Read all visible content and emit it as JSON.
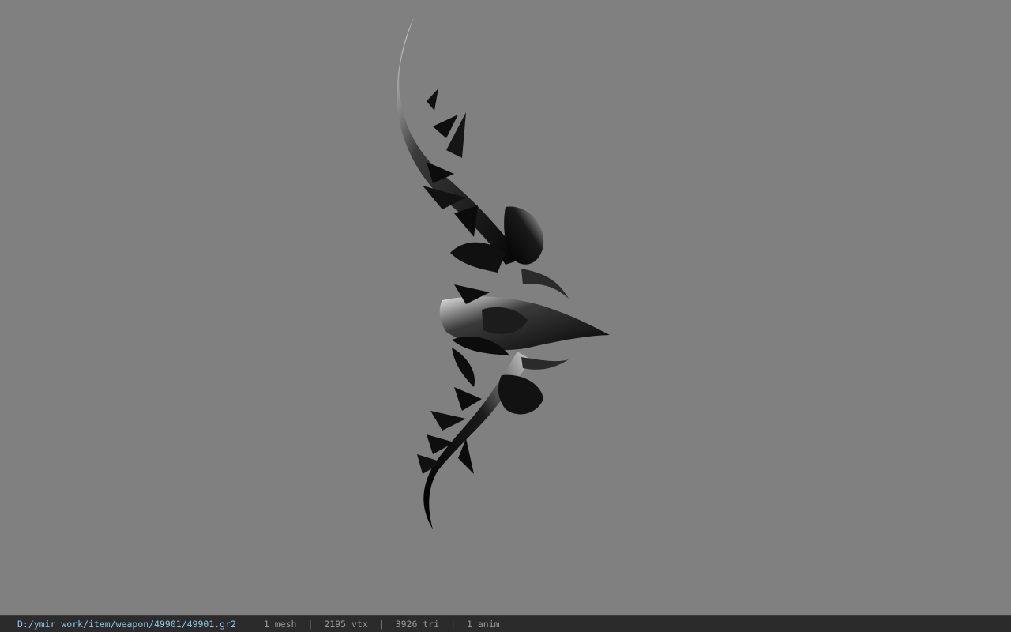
{
  "viewer": {
    "background_color": "#808080",
    "model": {
      "name": "bow-model",
      "color": "#0b0b0b",
      "highlight_color": "#d8d8d8"
    }
  },
  "status_bar": {
    "file_path": "D:/ymir work/item/weapon/49901/49901.gr2",
    "separator": "|",
    "mesh_count": "1 mesh",
    "vertex_count": "2195 vtx",
    "triangle_count": "3926 tri",
    "anim_count": "1 anim"
  }
}
